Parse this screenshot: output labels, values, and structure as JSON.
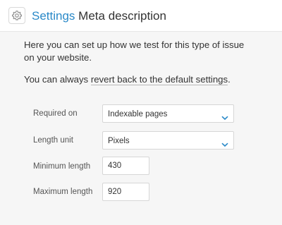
{
  "header": {
    "icon": "gear-icon",
    "breadcrumb": "Settings",
    "title": "Meta description",
    "accent_color": "#2a89c8"
  },
  "intro_text": "Here you can set up how we test for this type of issue on your website.",
  "revert": {
    "prefix": "You can always ",
    "link_label": "revert back to the default settings",
    "suffix": "."
  },
  "form": {
    "required_on": {
      "label": "Required on",
      "value": "Indexable pages"
    },
    "length_unit": {
      "label": "Length unit",
      "value": "Pixels"
    },
    "minimum_length": {
      "label": "Minimum length",
      "value": "430"
    },
    "maximum_length": {
      "label": "Maximum length",
      "value": "920"
    }
  }
}
